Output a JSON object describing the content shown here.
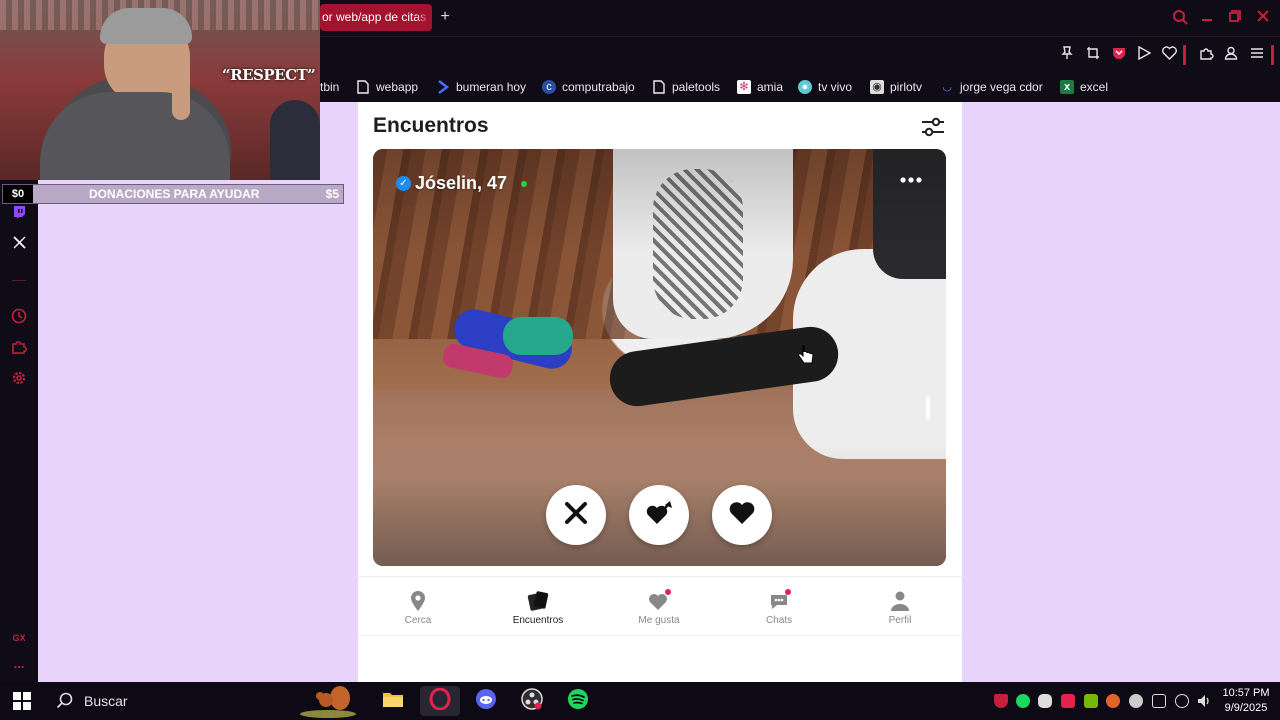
{
  "browser": {
    "active_tab_title": "or web/app de citas",
    "new_tab_label": "+",
    "bookmarks": [
      {
        "label": "tbin"
      },
      {
        "label": "webapp"
      },
      {
        "label": "bumeran hoy"
      },
      {
        "label": "computrabajo"
      },
      {
        "label": "paletools"
      },
      {
        "label": "amia"
      },
      {
        "label": "tv vivo"
      },
      {
        "label": "pirlotv"
      },
      {
        "label": "jorge vega cdor"
      },
      {
        "label": "excel"
      }
    ],
    "accent_color": "#c4203d"
  },
  "stream_overlay": {
    "webcam_caption": "“RESPECT”",
    "donation_current": "$0",
    "donation_label": "DONACIONES PARA AYUDAR",
    "donation_goal": "$5"
  },
  "sidebar": {
    "footer_label": "GX",
    "more_label": "..."
  },
  "app": {
    "page_title": "Encuentros",
    "profile": {
      "name": "Jóselin, 47",
      "verified": true,
      "online": true
    },
    "actions": [
      {
        "name": "dislike",
        "icon": "x-icon"
      },
      {
        "name": "crush",
        "icon": "heart-arrow-icon"
      },
      {
        "name": "like",
        "icon": "heart-icon"
      }
    ],
    "nav": [
      {
        "label": "Cerca",
        "icon": "location-pin-icon",
        "active": false,
        "badge": false
      },
      {
        "label": "Encuentros",
        "icon": "cards-icon",
        "active": true,
        "badge": false
      },
      {
        "label": "Me gusta",
        "icon": "hearts-icon",
        "active": false,
        "badge": true
      },
      {
        "label": "Chats",
        "icon": "chat-bubble-icon",
        "active": false,
        "badge": true
      },
      {
        "label": "Perfil",
        "icon": "person-icon",
        "active": false,
        "badge": false
      }
    ]
  },
  "taskbar": {
    "search_placeholder": "Buscar",
    "time": "10:57 PM",
    "date": "9/9/2025"
  }
}
